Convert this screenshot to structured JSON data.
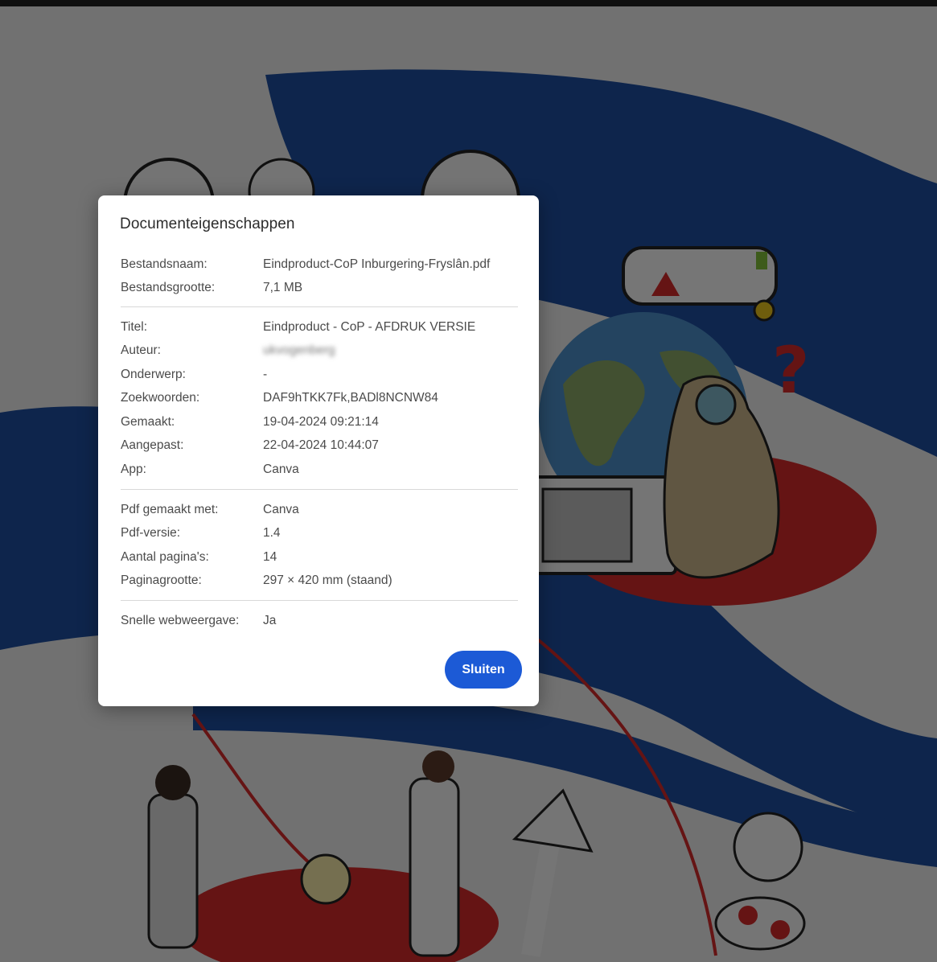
{
  "dialog": {
    "title": "Documenteigenschappen",
    "file": {
      "name_label": "Bestandsnaam:",
      "name_value": "Eindproduct-CoP Inburgering-Fryslân.pdf",
      "size_label": "Bestandsgrootte:",
      "size_value": "7,1 MB"
    },
    "meta": {
      "title_label": "Titel:",
      "title_value": "Eindproduct - CoP - AFDRUK VERSIE",
      "author_label": "Auteur:",
      "author_value": "ukvogenberg",
      "subject_label": "Onderwerp:",
      "subject_value": "-",
      "keywords_label": "Zoekwoorden:",
      "keywords_value": "DAF9hTKK7Fk,BADl8NCNW84",
      "created_label": "Gemaakt:",
      "created_value": "19-04-2024 09:21:14",
      "modified_label": "Aangepast:",
      "modified_value": "22-04-2024 10:44:07",
      "app_label": "App:",
      "app_value": "Canva"
    },
    "pdf": {
      "producer_label": "Pdf gemaakt met:",
      "producer_value": "Canva",
      "version_label": "Pdf-versie:",
      "version_value": "1.4",
      "pages_label": "Aantal pagina's:",
      "pages_value": "14",
      "pagesize_label": "Paginagrootte:",
      "pagesize_value": "297 × 420 mm (staand)"
    },
    "web": {
      "fastweb_label": "Snelle webweergave:",
      "fastweb_value": "Ja"
    },
    "close_label": "Sluiten"
  },
  "colors": {
    "accent": "#1c5ad6",
    "overlay": "#000000",
    "illustration_blue": "#1e4fa0",
    "illustration_red": "#d42a2a"
  }
}
